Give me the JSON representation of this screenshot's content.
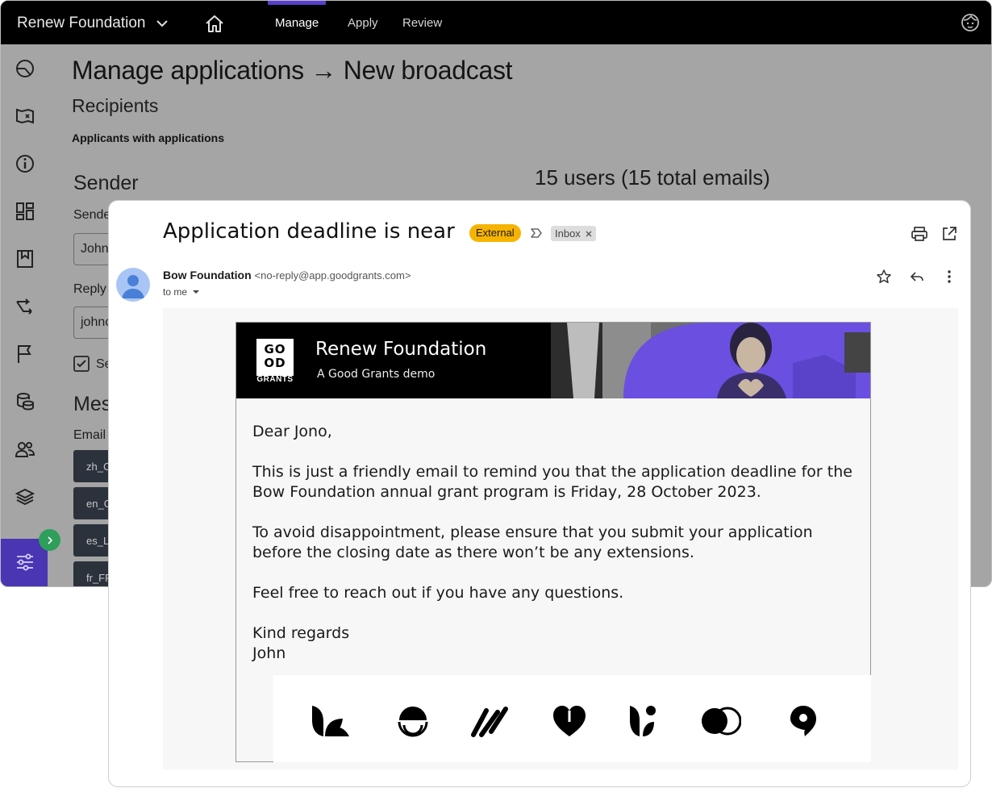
{
  "app": {
    "org_name": "Renew Foundation",
    "nav": [
      "Manage",
      "Apply",
      "Review"
    ],
    "active_nav": "Manage",
    "accent_color": "#4a35b3",
    "page_title": "Manage applications → New broadcast",
    "recipients_heading": "Recipients",
    "recipients_value": "Applicants with applications",
    "sender_heading": "Sender",
    "users_count": "15 users (15 total emails)",
    "sender_label": "Sende",
    "sender_value": "John",
    "reply_label": "Reply",
    "reply_value": "johnc",
    "checkbox_label": "Se",
    "message_heading": "Mes",
    "email_label": "Email",
    "languages": [
      "zh_C",
      "en_G",
      "es_L",
      "fr_FF"
    ]
  },
  "email": {
    "subject": "Application deadline is near",
    "badge_external": "External",
    "badge_inbox": "Inbox",
    "from_name": "Bow Foundation",
    "from_address": "<no-reply@app.goodgrants.com>",
    "to": "to me",
    "banner": {
      "logo_top": "GO",
      "logo_bottom": "OD",
      "logo_word": "GRANTS",
      "title": "Renew Foundation",
      "subtitle": "A Good Grants demo"
    },
    "body": {
      "greeting": "Dear Jono,",
      "p1": "This is just a friendly email to remind you that the application deadline for the Bow Foundation annual grant program is Friday, 28 October 2023.",
      "p2": "To avoid disappointment, please ensure that you submit your application before the closing date as there won’t be any extensions.",
      "p3": "Feel free to reach out if you have any questions.",
      "closing": "Kind regards",
      "signature": "John"
    },
    "badge_external_color": "#f6b400"
  }
}
